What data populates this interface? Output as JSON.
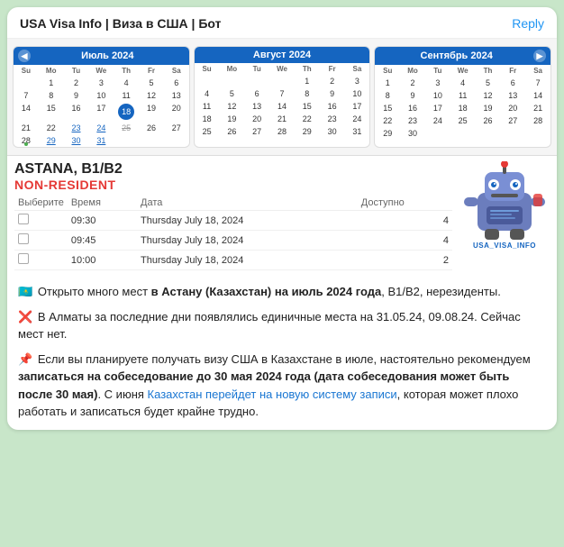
{
  "header": {
    "title": "USA Visa Info | Виза в США | Бот",
    "reply_label": "Reply"
  },
  "calendars": [
    {
      "month": "Июль 2024",
      "days_of_week": [
        "Su",
        "Mo",
        "Tu",
        "We",
        "Th",
        "Fr",
        "Sa"
      ],
      "weeks": [
        [
          null,
          1,
          2,
          3,
          4,
          5,
          6
        ],
        [
          7,
          8,
          9,
          10,
          11,
          12,
          13
        ],
        [
          14,
          15,
          16,
          17,
          "18h",
          19,
          20
        ],
        [
          21,
          22,
          "23u",
          "24u",
          "25s",
          26,
          27
        ],
        [
          "28g",
          "29u",
          "30u",
          "31u",
          null,
          null,
          null
        ]
      ]
    },
    {
      "month": "Август 2024",
      "days_of_week": [
        "Su",
        "Mo",
        "Tu",
        "We",
        "Th",
        "Fr",
        "Sa"
      ],
      "weeks": [
        [
          null,
          null,
          null,
          null,
          1,
          2,
          3
        ],
        [
          4,
          5,
          6,
          7,
          8,
          9,
          10
        ],
        [
          11,
          12,
          13,
          14,
          15,
          16,
          17
        ],
        [
          18,
          19,
          20,
          21,
          22,
          23,
          24
        ],
        [
          25,
          26,
          27,
          28,
          29,
          30,
          31
        ]
      ]
    },
    {
      "month": "Сентябрь 2024",
      "days_of_week": [
        "Su",
        "Mo",
        "Tu",
        "We",
        "Th",
        "Fr",
        "Sa"
      ],
      "weeks": [
        [
          1,
          2,
          3,
          4,
          5,
          6,
          7
        ],
        [
          8,
          9,
          10,
          11,
          12,
          13,
          14
        ],
        [
          15,
          16,
          17,
          18,
          19,
          20,
          21
        ],
        [
          22,
          23,
          24,
          25,
          26,
          27,
          28
        ],
        [
          29,
          30,
          null,
          null,
          null,
          null,
          null
        ]
      ]
    }
  ],
  "location": {
    "city": "ASTANA, B1/B2",
    "resident_status": "NON-RESIDENT"
  },
  "slots_table": {
    "headers": [
      "Выберите",
      "Время",
      "Дата",
      "",
      "Доступно"
    ],
    "rows": [
      {
        "time": "09:30",
        "date": "Thursday July 18, 2024",
        "available": 4
      },
      {
        "time": "09:45",
        "date": "Thursday July 18, 2024",
        "available": 4
      },
      {
        "time": "10:00",
        "date": "Thursday July 18, 2024",
        "available": 2
      }
    ]
  },
  "messages": [
    {
      "icon": "🇰🇿",
      "text_parts": [
        {
          "text": "Открыто много мест ",
          "bold": false
        },
        {
          "text": "в Астану (Казахстан) на июль 2024 года",
          "bold": true
        },
        {
          "text": ", B1/B2, нерезиденты.",
          "bold": false
        }
      ]
    },
    {
      "icon": "❌",
      "text_parts": [
        {
          "text": "В Алматы за последние дни появлялись единичные места на 31.05.24, 09.08.24. Сейчас мест нет.",
          "bold": false
        }
      ]
    },
    {
      "icon": "📌",
      "text_parts": [
        {
          "text": "Если вы планируете получать визу США в Казахстане в ",
          "bold": false
        },
        {
          "text": "июле",
          "bold": false
        },
        {
          "text": ", настоятельно рекомендуем ",
          "bold": false
        },
        {
          "text": "записаться на собеседование до 30 мая 2024 года (дата собеседования может быть после 30 мая)",
          "bold": true
        },
        {
          "text": ". С июня ",
          "bold": false
        },
        {
          "text": "Казахстан перейдет на новую систему записи",
          "bold": false,
          "link": true
        },
        {
          "text": ", которая может плохо работать и записаться будет крайне трудно.",
          "bold": false
        }
      ]
    }
  ]
}
